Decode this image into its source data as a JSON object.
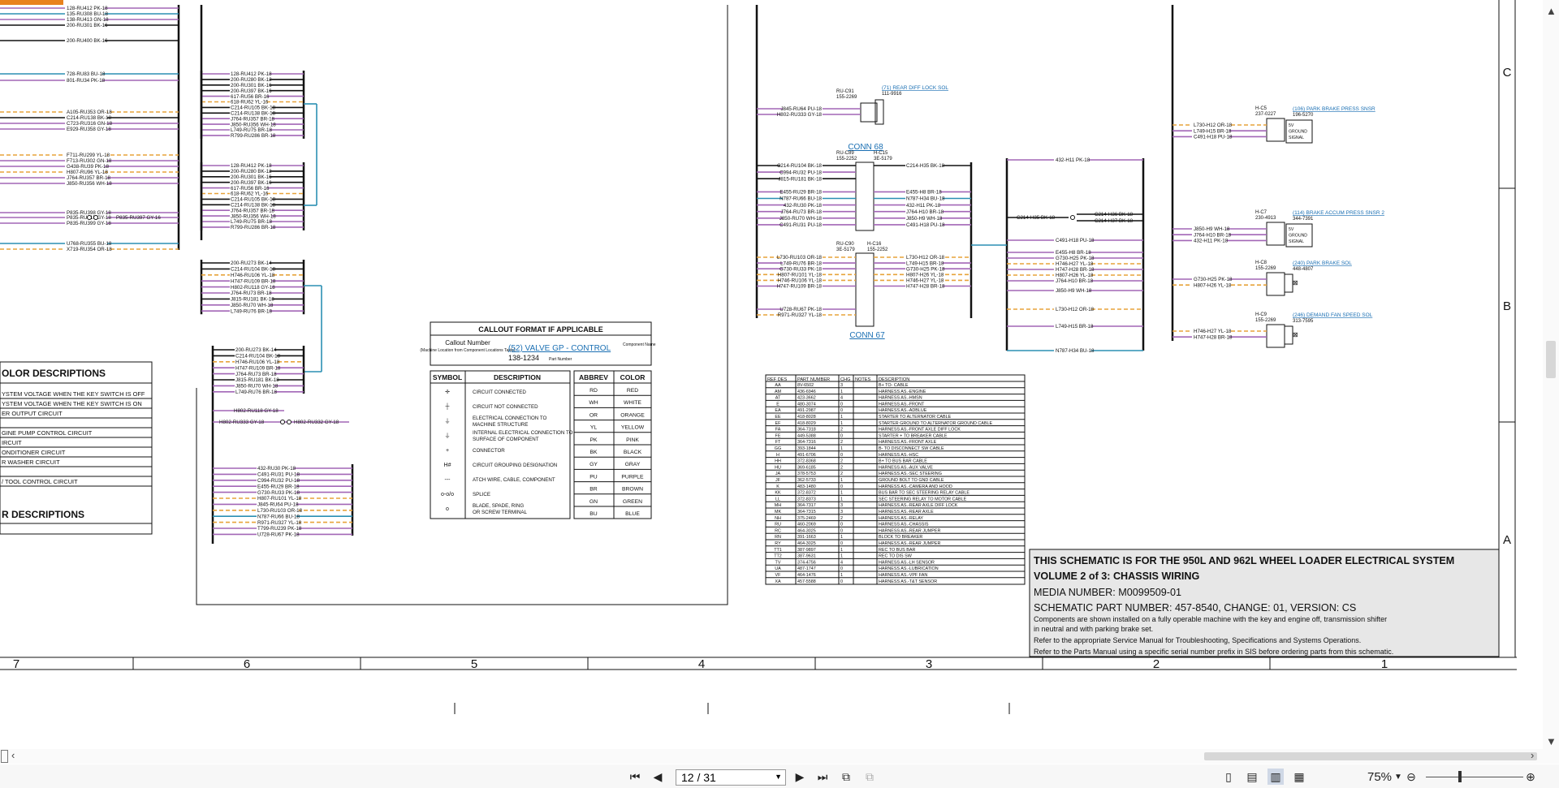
{
  "colors": {
    "accent": "#e8821e",
    "wire_purple": "#a266b6",
    "wire_orange": "#e7a33a",
    "wire_blue": "#2b8fb3",
    "link": "#1a6fb3"
  },
  "schematic": {
    "left_wires": [
      "128-RU412 PK-18",
      "135-RU308 BU-18",
      "138-RU413 GN-18",
      "200-RU301 BK-16",
      "200-RU400 BK-16",
      "728-RU83 BU-18",
      "801-RU34 PK-18",
      "A105-RU353 OR-18",
      "C214-RU138 BK-18",
      "C723-RU316 GN-18",
      "E929-RU358 GY-18",
      "F711-RU299 YL-18",
      "F713-RU302 GN-18",
      "G438-RU39 PK-18",
      "H807-RU96 YL-18",
      "J764-RU357 BR-18",
      "J850-RU356 WH-18",
      "P835-RU398 GY-18",
      "P835-RU315 GY-18",
      "P835-RU399 GY-18",
      "U768-RU355 BU-18",
      "X719-RU354 OR-18"
    ],
    "splice_out_label": "P835-RU397 GY-16",
    "mid_wires_1": [
      "128-RU412 PK-18",
      "200-RU280 BK-12",
      "200-RU301 BK-16",
      "200-RU397 BK-16",
      "617-RU56 BR-16",
      "618-RU62 YL-16",
      "C214-RU105 BK-18",
      "C214-RU138 BK-18",
      "J764-RU357 BR-18",
      "J850-RU356 WH-18",
      "L749-RU75 BR-18",
      "R799-RU286 BR-18"
    ],
    "mid_wires_2": [
      "128-RU412 PK-18",
      "200-RU280 BK-12",
      "200-RU301 BK-16",
      "200-RU397 BK-16",
      "617-RU56 BR-16",
      "618-RU62 YL-16",
      "C214-RU105 BK-18",
      "C214-RU138 BK-18",
      "J764-RU357 BR-18",
      "J850-RU356 WH-18",
      "L749-RU75 BR-18",
      "R799-RU286 BR-18"
    ],
    "mid_wires_3": [
      "200-RU273 BK-14",
      "C214-RU104 BK-18",
      "H746-RU106 YL-18",
      "H747-RU109 BR-18",
      "H802-RU118 GY-18",
      "J764-RU73 BR-18",
      "J815-RU181 BK-18",
      "J850-RU70 WH-18",
      "L749-RU76 BR-18"
    ],
    "mid_wires_4": [
      "200-RU273 BK-14",
      "C214-RU104 BK-18",
      "H746-RU106 YL-18",
      "H747-RU109 BR-18",
      "J764-RU73 BR-18",
      "J815-RU181 BK-18",
      "J850-RU70 WH-18",
      "L749-RU76 BR-18"
    ],
    "mid_splice_left": "H802-RU333 GY-18",
    "mid_splice_right": "H802-RU332 GY-18",
    "mid_splice_top": "H802-RU118 GY-18",
    "mid_wires_5": [
      "432-RU30 PK-18",
      "C491-RU31 PU-18",
      "C994-RU32 PU-18",
      "E455-RU29 BR-18",
      "G730-RU33 PK-18",
      "H807-RU101 YL-18",
      "J845-RU64 PU-18",
      "L730-RU103 OR-18",
      "N787-RU66 BU-18",
      "R971-RU327 YL-18",
      "T799-RU239 PK-18",
      "U728-RU67 PK-18"
    ],
    "color_desc_title": "OLOR DESCRIPTIONS",
    "color_desc_lines": [
      "YSTEM VOLTAGE WHEN THE KEY SWITCH IS OFF",
      "YSTEM VOLTAGE WHEN THE KEY SWITCH IS ON",
      "ER OUTPUT CIRCUIT",
      "",
      "GINE PUMP CONTROL CIRCUIT",
      "IRCUIT",
      "ONDITIONER CIRCUIT",
      "R WASHER CIRCUIT",
      "",
      "/ TOOL CONTROL CIRCUIT"
    ],
    "other_desc_title": "R DESCRIPTIONS",
    "callout": {
      "title": "CALLOUT FORMAT IF APPLICABLE",
      "callout_number": "Callout Number",
      "machine_loc": "(Machine Location from Component Locations Table)",
      "example_link": "(52) VALVE GP - CONTROL",
      "component_name": "Component Name",
      "part_number": "138-1234",
      "part_number_label": "Part Number"
    },
    "symbol_table": {
      "headers": [
        "SYMBOL",
        "DESCRIPTION"
      ],
      "rows": [
        {
          "sym": "✛",
          "desc": "CIRCUIT CONNECTED"
        },
        {
          "sym": "┼",
          "desc": "CIRCUIT NOT CONNECTED"
        },
        {
          "sym": "⏚",
          "desc": "ELECTRICAL CONNECTION TO MACHINE STRUCTURE"
        },
        {
          "sym": "⏚",
          "desc": "INTERNAL ELECTRICAL CONNECTION TO SURFACE OF COMPONENT"
        },
        {
          "sym": "+",
          "desc": "CONNECTOR"
        },
        {
          "sym": "H#",
          "desc": "CIRCUIT GROUPING DESIGNATION"
        },
        {
          "sym": "---",
          "desc": "ATCH WIRE, CABLE, COMPONENT"
        },
        {
          "sym": "o-o/o",
          "desc": "SPLICE"
        },
        {
          "sym": "o",
          "desc": "BLADE, SPADE, RING OR SCREW TERMINAL"
        }
      ]
    },
    "abbrev_table": {
      "headers": [
        "ABBREV",
        "COLOR"
      ],
      "rows": [
        [
          "RD",
          "RED"
        ],
        [
          "WH",
          "WHITE"
        ],
        [
          "OR",
          "ORANGE"
        ],
        [
          "YL",
          "YELLOW"
        ],
        [
          "PK",
          "PINK"
        ],
        [
          "BK",
          "BLACK"
        ],
        [
          "GY",
          "GRAY"
        ],
        [
          "PU",
          "PURPLE"
        ],
        [
          "BR",
          "BROWN"
        ],
        [
          "GN",
          "GREEN"
        ],
        [
          "BU",
          "BLUE"
        ]
      ]
    },
    "conn68": {
      "title": "CONN 68",
      "ru": "RU-C89",
      "ru_pn": "155-2252",
      "h": "H-C15",
      "h_pn": "3E-5179",
      "left": [
        "C214-RU104 BK-18",
        "C994-RU32 PU-18",
        "J815-RU181 BK-18",
        "",
        "E455-RU29 BR-18",
        "N787-RU66 BU-18",
        "432-RU30 PK-18",
        "J764-RU73 BR-18",
        "J850-RU70 WH-18",
        "C491-RU31 PU-18"
      ],
      "right": [
        "C214-H35 BK-18",
        "",
        "",
        "",
        "E455-H8 BR-18",
        "N787-H34 BU-18",
        "432-H11 PK-18",
        "J764-H10 BR-18",
        "J850-H9 WH-18",
        "C491-H18 PU-18"
      ]
    },
    "conn67": {
      "title": "CONN 67",
      "ru": "RU-C90",
      "ru_pn": "3E-5179",
      "h": "H-C16",
      "h_pn": "155-2252",
      "left": [
        "L730-RU103 OR-18",
        "L749-RU76 BR-18",
        "G730-RU33 PK-18",
        "H807-RU101 YL-18",
        "H746-RU106 YL-18",
        "H747-RU109 BR-18"
      ],
      "right": [
        "L730-H12 OR-18",
        "L749-H15 BR-18",
        "G730-H25 PK-18",
        "H807-H26 YL-18",
        "H746-H27 YL-18",
        "H747-H28 BR-18"
      ]
    },
    "rear_diff": {
      "ru": "RU-C91",
      "ru_pn": "155-2269",
      "link": "(71) REAR DIFF LOCK SOL",
      "pn": "111-9916",
      "wires": [
        "J845-RU64 PU-18",
        "H802-RU333 GY-18"
      ]
    },
    "conn67_extra": [
      "U728-RU67 PK-18",
      "R971-RU327 YL-18"
    ],
    "right_bus_wires": [
      "432-H11 PK-18",
      "C214-H35 BK-18",
      "C214-H36 BK-18",
      "C214-H37 BK-18",
      "C491-H18 PU-18",
      "E455-H8 BR-18",
      "G730-H25 PK-18",
      "H746-H27 YL-18",
      "H747-H28 BR-18",
      "H807-H26 YL-18",
      "J764-H10 BR-18",
      "J850-H9 WH-18",
      "L730-H12 OR-18",
      "L749-H15 BR-18",
      "N787-H34 BU-18"
    ],
    "components": [
      {
        "id": "H-C5",
        "pn": "237-0227",
        "link": "(106) PARK BRAKE PRESS SNSR",
        "cpn": "196-5270",
        "pins": [
          "5V",
          "GROUND",
          "SIGNAL"
        ],
        "wires": [
          "L730-H12 OR-18",
          "L749-H15 BR-18",
          "C491-H18 PU-18"
        ]
      },
      {
        "id": "H-C7",
        "pn": "230-4913",
        "link": "(114) BRAKE ACCUM PRESS SNSR 2",
        "cpn": "344-7391",
        "pins": [
          "5V",
          "GROUND",
          "SIGNAL"
        ],
        "wires": [
          "J850-H9 WH-18",
          "J764-H10 BR-18",
          "432-H11 PK-18"
        ]
      },
      {
        "id": "H-C8",
        "pn": "155-2269",
        "link": "(240) PARK BRAKE SOL",
        "cpn": "448-4807",
        "pins": [],
        "wires": [
          "G730-H25 PK-18",
          "H807-H26 YL-18"
        ]
      },
      {
        "id": "H-C9",
        "pn": "155-2269",
        "link": "(246) DEMAND FAN SPEED SOL",
        "cpn": "313-7595",
        "pins": [],
        "wires": [
          "H746-H27 YL-18",
          "H747-H28 BR-18"
        ]
      }
    ],
    "refdes": {
      "headers": [
        "REF DES",
        "PART NUMBER",
        "CHG",
        "NOTES",
        "DESCRIPTION"
      ],
      "rows": [
        [
          "AA",
          "8V-6502",
          "3",
          "",
          "B+ TO- CABLE"
        ],
        [
          "AM",
          "436-6946",
          "1",
          "",
          "HARNESS AS.-ENGINE"
        ],
        [
          "AT",
          "423-3662",
          "4",
          "",
          "HARNESS AS.-HMSN"
        ],
        [
          "E",
          "480-3074",
          "0",
          "",
          "HARNESS AS.-FRONT"
        ],
        [
          "EA",
          "491-2987",
          "0",
          "",
          "HARNESS AS.-ADBLUE"
        ],
        [
          "EE",
          "418-8028",
          "1",
          "",
          "STARTER TO ALTERNATOR CABLE"
        ],
        [
          "EF",
          "418-8029",
          "1",
          "",
          "STARTER GROUND TO ALTERNATOR GROUND CABLE"
        ],
        [
          "FA",
          "364-7318",
          "2",
          "",
          "HARNESS AS.-FRONT AXLE DIFF LOCK"
        ],
        [
          "FE",
          "449-5388",
          "0",
          "",
          "STARTER + TO BREAKER CABLE"
        ],
        [
          "FT",
          "364-7316",
          "2",
          "",
          "HARNESS AS.-FRONT AXLE"
        ],
        [
          "GG",
          "393-1844",
          "1",
          "",
          "B- TO DISCONNECT SW CABLE"
        ],
        [
          "H",
          "491-6706",
          "0",
          "",
          "HARNESS AS.-HSC"
        ],
        [
          "HH",
          "372-8368",
          "2",
          "",
          "B+ TO BUS BAR CABLE"
        ],
        [
          "HU",
          "369-6185",
          "2",
          "",
          "HARNESS AS.-AUX VALVE"
        ],
        [
          "JA",
          "378-5753",
          "2",
          "",
          "HARNESS AS.-SEC STEERING"
        ],
        [
          "JF",
          "362-5733",
          "1",
          "",
          "GROUND BOLT TO GND CABLE"
        ],
        [
          "K",
          "483-1480",
          "0",
          "",
          "HARNESS AS.-CAMERA AND HOOD"
        ],
        [
          "KK",
          "372-8372",
          "1",
          "",
          "BUS BAR TO SEC STEERING RELAY CABLE"
        ],
        [
          "LL",
          "372-8373",
          "1",
          "",
          "SEC STEERING RELAY TO MOTOR CABLE"
        ],
        [
          "MH",
          "364-7317",
          "3",
          "",
          "HARNESS AS.-REAR AXLE DIFF LOCK"
        ],
        [
          "MK",
          "364-7315",
          "3",
          "",
          "HARNESS AS.-REAR AXLE"
        ],
        [
          "NH",
          "375-2469",
          "2",
          "",
          "HARNESS AS.-RELAY"
        ],
        [
          "RU",
          "460-2069",
          "0",
          "",
          "HARNESS AS.-CHASSIS"
        ],
        [
          "RC",
          "464-3025",
          "0",
          "",
          "HARNESS AS.-REAR JUMPER"
        ],
        [
          "RN",
          "391-1663",
          "1",
          "",
          "BLOCK TO BREAKER"
        ],
        [
          "RY",
          "464-3025",
          "0",
          "",
          "HARNESS AS.-REAR JUMPER"
        ],
        [
          "TT1",
          "387-9897",
          "1",
          "",
          "REC TO BUS BAR"
        ],
        [
          "TT2",
          "387-9631",
          "1",
          "",
          "REC TO DIS SW"
        ],
        [
          "TV",
          "374-4756",
          "4",
          "",
          "HARNESS AS.-LH SENSOR"
        ],
        [
          "UA",
          "487-1747",
          "0",
          "",
          "HARNESS AS.-LUBRICATION"
        ],
        [
          "VF",
          "464-1476",
          "1",
          "",
          "HARNESS AS.-VPF FAN"
        ],
        [
          "XA",
          "457-5588",
          "0",
          "",
          "HARNESS AS.-T&T SENSOR"
        ]
      ]
    },
    "title_block": {
      "line1": "THIS SCHEMATIC IS FOR THE 950L AND 962L WHEEL LOADER ELECTRICAL SYSTEM",
      "line2": "VOLUME 2 of 3: CHASSIS WIRING",
      "media": "MEDIA NUMBER: M0099509-01",
      "part": "SCHEMATIC PART NUMBER: 457-8540, CHANGE: 01, VERSION: CS",
      "note1": "Components are shown installed on a fully operable machine with the key and engine off, transmission shifter",
      "note2": "in neutral and with parking brake set.",
      "note3": "Refer to the appropriate Service Manual for Troubleshooting, Specifications and Systems Operations.",
      "note4": "Refer to the Parts Manual using a specific serial number prefix in SIS before ordering parts from this schematic."
    },
    "grid_cols": [
      "7",
      "6",
      "5",
      "4",
      "3",
      "2",
      "1"
    ],
    "grid_rows": [
      "C",
      "B",
      "A"
    ]
  },
  "viewer": {
    "page_indicator": "12 / 31",
    "zoom": "75%",
    "scroll_left_icon": "chevron-left-icon",
    "scroll_right_icon": "chevron-right-icon"
  }
}
